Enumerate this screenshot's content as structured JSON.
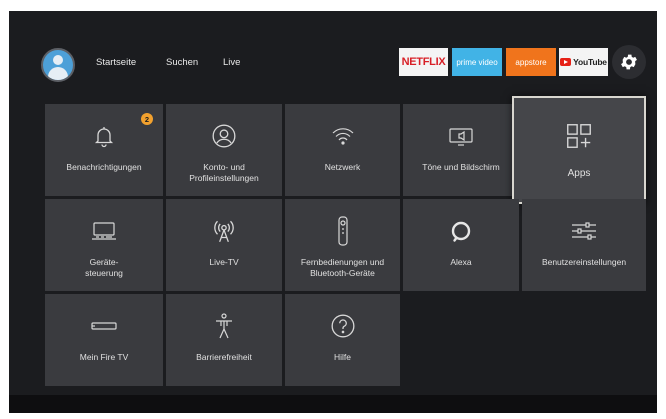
{
  "nav": {
    "home": "Startseite",
    "search": "Suchen",
    "live": "Live"
  },
  "partners": {
    "netflix": "NETFLIX",
    "prime": "prime video",
    "appstore": "appstore",
    "youtube": "YouTube"
  },
  "tiles": [
    {
      "label": "Benachrichtigungen",
      "icon": "bell-icon",
      "badge": "2"
    },
    {
      "label": "Konto- und Profileinstellungen",
      "icon": "user-circle-icon"
    },
    {
      "label": "Netzwerk",
      "icon": "wifi-icon"
    },
    {
      "label": "Töne und Bildschirm",
      "icon": "display-sound-icon"
    },
    {
      "label": "Apps",
      "icon": "apps-grid-icon",
      "focused": true
    },
    {
      "label": "Geräte-steuerung",
      "icon": "tv-icon"
    },
    {
      "label": "Live-TV",
      "icon": "antenna-icon"
    },
    {
      "label": "Fernbedienungen und Bluetooth-Geräte",
      "icon": "remote-icon"
    },
    {
      "label": "Alexa",
      "icon": "alexa-icon"
    },
    {
      "label": "Benutzereinstellungen",
      "icon": "sliders-icon"
    },
    {
      "label": "Mein Fire TV",
      "icon": "fire-tv-stick-icon"
    },
    {
      "label": "Barrierefreiheit",
      "icon": "accessibility-icon"
    },
    {
      "label": "Hilfe",
      "icon": "help-icon"
    }
  ],
  "colors": {
    "background": "#1b1c1f",
    "tile": "#3a3b3f",
    "badge": "#f2a12e",
    "netflix": "#d81f26",
    "prime": "#41b3e6",
    "appstore": "#f0741c"
  }
}
